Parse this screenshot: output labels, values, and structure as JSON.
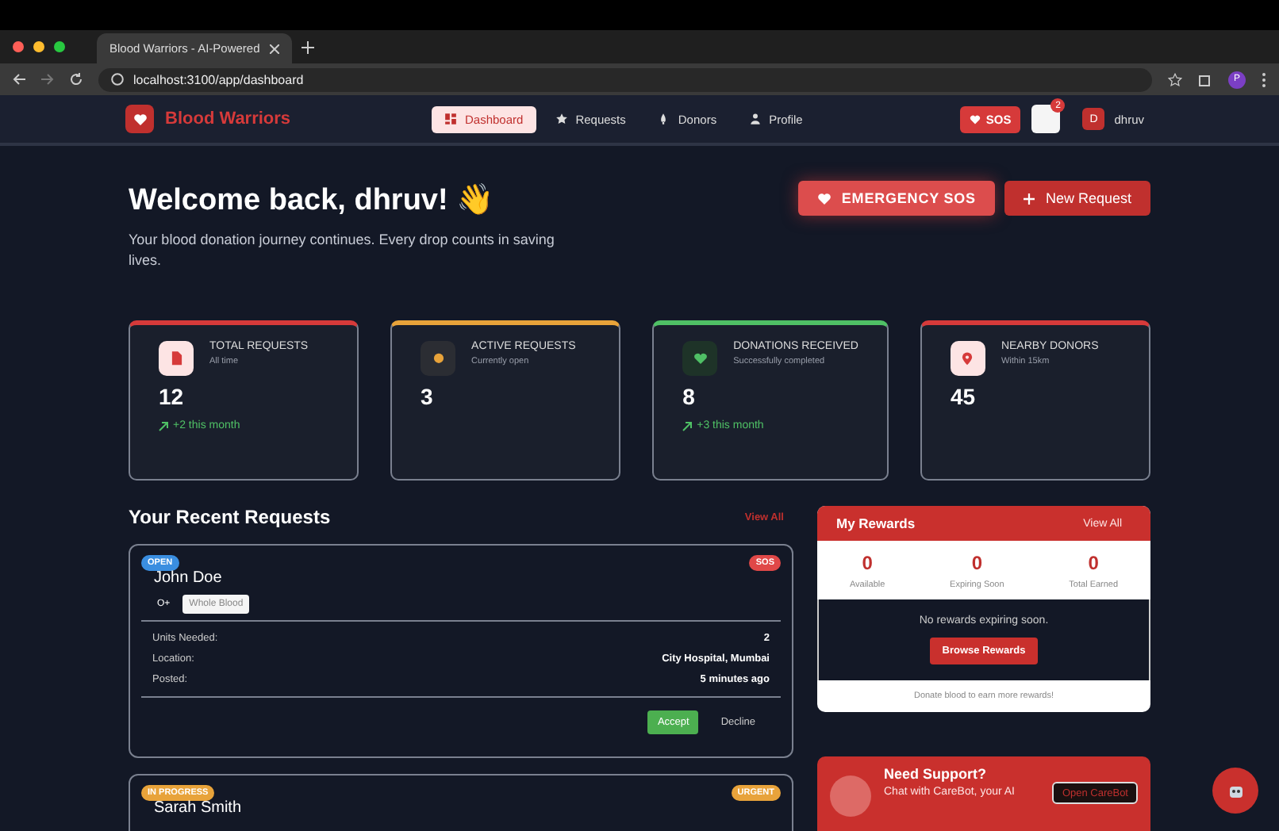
{
  "browser": {
    "tab_title": "Blood Warriors - AI-Powered",
    "url": "localhost:3100/app/dashboard",
    "profile_initial": "P"
  },
  "nav": {
    "brand": "Blood Warriors",
    "items": [
      {
        "label": "Dashboard",
        "selected": true
      },
      {
        "label": "Requests",
        "selected": false
      },
      {
        "label": "Donors",
        "selected": false
      },
      {
        "label": "Profile",
        "selected": false
      }
    ],
    "sos": "SOS",
    "notification_count": "2",
    "user_initial": "D",
    "user_name": "dhruv"
  },
  "welcome": {
    "title": "Welcome back, dhruv! 👋",
    "subtitle": "Your blood donation journey continues. Every drop counts in saving lives.",
    "emergency_button": "EMERGENCY SOS",
    "new_request_button": "New Request"
  },
  "stats": [
    {
      "title": "TOTAL REQUESTS",
      "subtitle": "All time",
      "value": "12",
      "trend": "+2 this month",
      "color": "#d63a3a"
    },
    {
      "title": "ACTIVE REQUESTS",
      "subtitle": "Currently open",
      "value": "3",
      "color": "#e8a33a"
    },
    {
      "title": "DONATIONS RECEIVED",
      "subtitle": "Successfully completed",
      "value": "8",
      "trend": "+3 this month",
      "color": "#4fc065"
    },
    {
      "title": "NEARBY DONORS",
      "subtitle": "Within 15km",
      "value": "45",
      "color": "#d63a3a"
    }
  ],
  "recent": {
    "title": "Your Recent Requests",
    "view_all": "View All",
    "requests": [
      {
        "status": {
          "label": "OPEN",
          "color": "#3a8ee0"
        },
        "priority": {
          "label": "SOS",
          "color": "#e04848"
        },
        "name": "John Doe",
        "blood_type": "O+",
        "component": "Whole Blood",
        "details": [
          {
            "label": "Units Needed:",
            "value": "2"
          },
          {
            "label": "Location:",
            "value": "City Hospital, Mumbai"
          },
          {
            "label": "Posted:",
            "value": "5 minutes ago"
          }
        ],
        "actions": [
          "Accept",
          "Decline"
        ]
      },
      {
        "status": {
          "label": "IN PROGRESS",
          "color": "#e8a33a"
        },
        "priority": {
          "label": "URGENT",
          "color": "#e8a33b"
        },
        "name": "Sarah Smith"
      }
    ]
  },
  "rewards": {
    "title": "My Rewards",
    "view_all": "View All",
    "counts": [
      {
        "value": "0",
        "label": "Available"
      },
      {
        "value": "0",
        "label": "Expiring Soon"
      },
      {
        "value": "0",
        "label": "Total Earned"
      }
    ],
    "message": "No rewards expiring soon.",
    "browse_button": "Browse Rewards",
    "footer": "Donate blood to earn more rewards!"
  },
  "support": {
    "title": "Need Support?",
    "text": "Chat with CareBot, your AI",
    "button": "Open CareBot"
  }
}
